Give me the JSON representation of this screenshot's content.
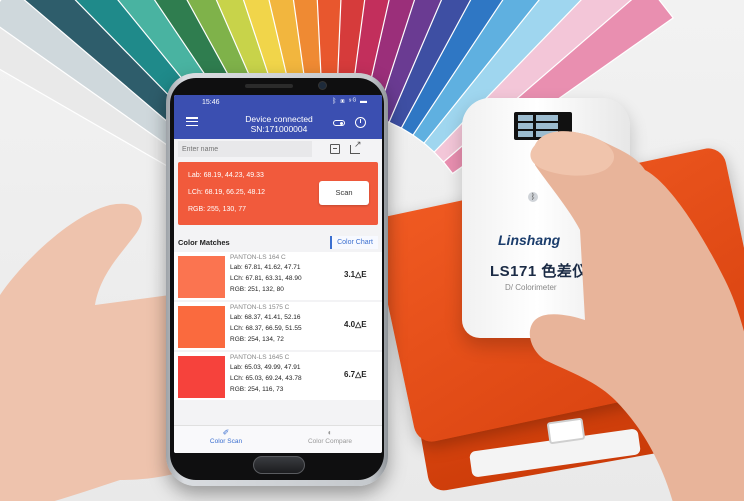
{
  "phone_app": {
    "status_time": "15:46",
    "status_icons": "ᛒ ▣ ⁹ᴳ ▬",
    "title_line1": "Device connected",
    "title_line2": "SN:171000004",
    "name_placeholder": "Enter name",
    "result": {
      "lab": "Lab: 68.19, 44.23, 49.33",
      "lch": "LCh: 68.19, 66.25, 48.12",
      "rgb": "RGB: 255, 130, 77",
      "color": "#f15a3c"
    },
    "scan_label": "Scan",
    "matches_title": "Color Matches",
    "color_chart_tab": "Color Chart",
    "matches": [
      {
        "name": "PANTON-LS 164 C",
        "lab": "Lab: 67.81, 41.62, 47.71",
        "lch": "LCh: 67.81, 63.31, 48.90",
        "rgb": "RGB: 251, 132, 80",
        "delta_e": "3.1△E",
        "color": "#fb7450"
      },
      {
        "name": "PANTON-LS 1575 C",
        "lab": "Lab: 68.37, 41.41, 52.16",
        "lch": "LCh: 68.37, 66.59, 51.55",
        "rgb": "RGB: 254, 134, 72",
        "delta_e": "4.0△E",
        "color": "#fa6a3e"
      },
      {
        "name": "PANTON-LS 1645 C",
        "lab": "Lab: 65.03, 49.99, 47.91",
        "lch": "LCh: 65.03, 69.24, 43.78",
        "rgb": "RGB: 254, 116, 73",
        "delta_e": "6.7△E",
        "color": "#f6423c"
      }
    ],
    "nav": [
      {
        "label": "Color Scan",
        "icon": "eyedropper-icon",
        "glyph": "✐",
        "active": true
      },
      {
        "label": "Color Compare",
        "icon": "compare-icon",
        "glyph": "◐",
        "active": false
      }
    ],
    "accent": "#3b4fb1"
  },
  "device": {
    "brand": "Linshang",
    "model": "LS171 色差仪",
    "subtitle": "D/  Colorimeter"
  }
}
